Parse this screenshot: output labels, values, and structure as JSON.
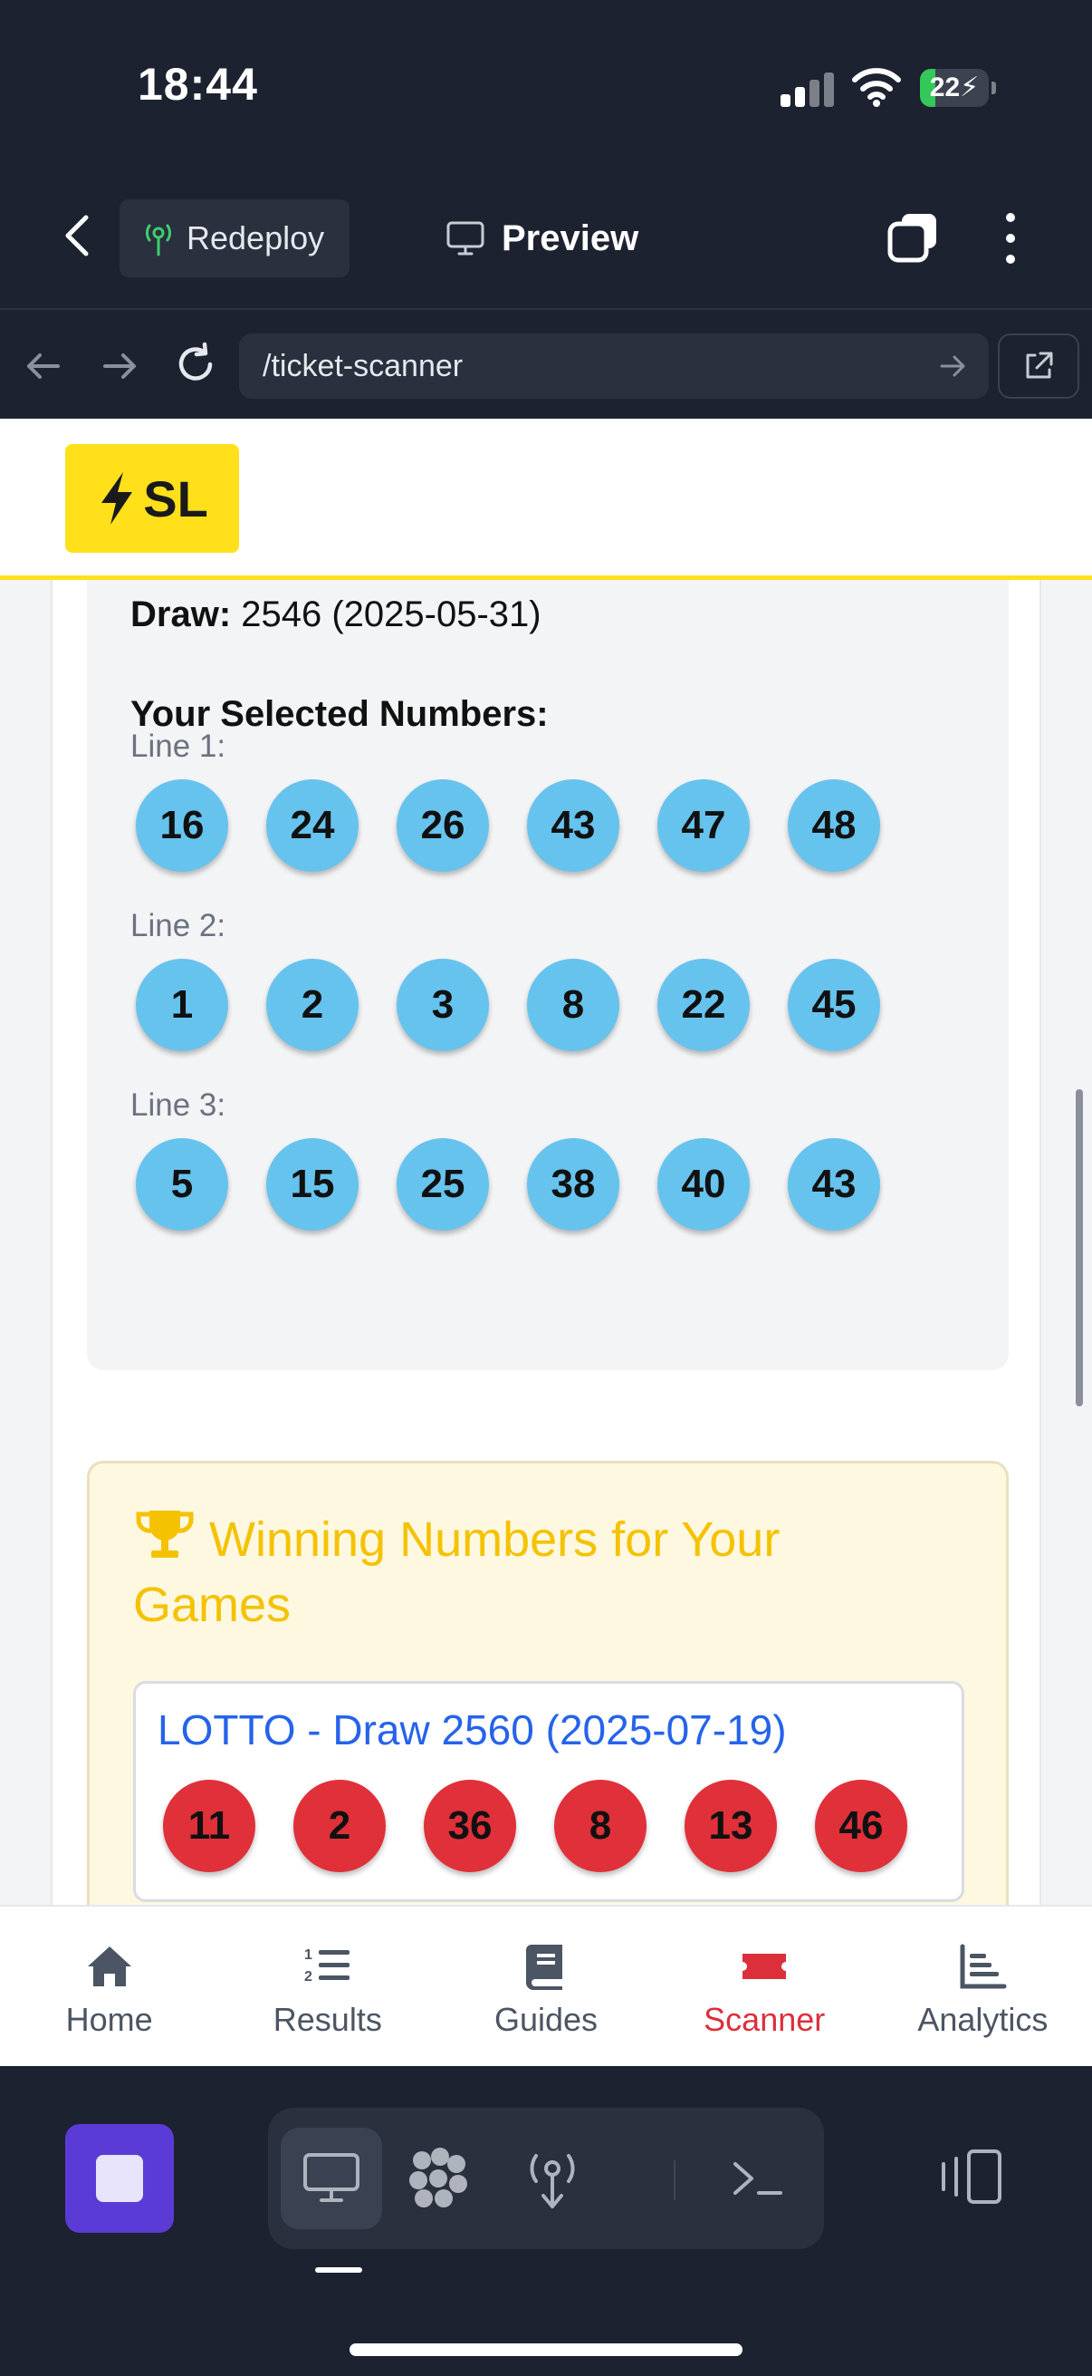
{
  "status_bar": {
    "time": "18:44",
    "battery_level": "22",
    "battery_fraction": 0.22
  },
  "toolbar": {
    "redeploy_label": "Redeploy",
    "preview_label": "Preview"
  },
  "url_bar": {
    "url": "/ticket-scanner"
  },
  "site": {
    "logo_text": "SL"
  },
  "ticket": {
    "draw_label": "Draw:",
    "draw_value": "2546 (2025-05-31)",
    "selected_title": "Your Selected Numbers:",
    "lines": [
      {
        "label": "Line 1:",
        "numbers": [
          "16",
          "24",
          "26",
          "43",
          "47",
          "48"
        ]
      },
      {
        "label": "Line 2:",
        "numbers": [
          "1",
          "2",
          "3",
          "8",
          "22",
          "45"
        ]
      },
      {
        "label": "Line 3:",
        "numbers": [
          "5",
          "15",
          "25",
          "38",
          "40",
          "43"
        ]
      }
    ]
  },
  "winning": {
    "title": "Winning Numbers for Your Games",
    "game_title": "LOTTO - Draw 2560 (2025-07-19)",
    "numbers": [
      "11",
      "2",
      "36",
      "8",
      "13",
      "46"
    ]
  },
  "bottom_nav": [
    {
      "label": "Home",
      "icon": "home-icon",
      "active": false
    },
    {
      "label": "Results",
      "icon": "list-ordered-icon",
      "active": false
    },
    {
      "label": "Guides",
      "icon": "book-icon",
      "active": false
    },
    {
      "label": "Scanner",
      "icon": "ticket-icon",
      "active": true
    },
    {
      "label": "Analytics",
      "icon": "bar-chart-icon",
      "active": false
    }
  ],
  "colors": {
    "accent_yellow": "#ffe01b",
    "ball_blue": "#66c3ee",
    "ball_red": "#e0303a",
    "active_nav": "#dc2f3c",
    "win_title": "#f5c200",
    "link_blue": "#2563eb"
  }
}
